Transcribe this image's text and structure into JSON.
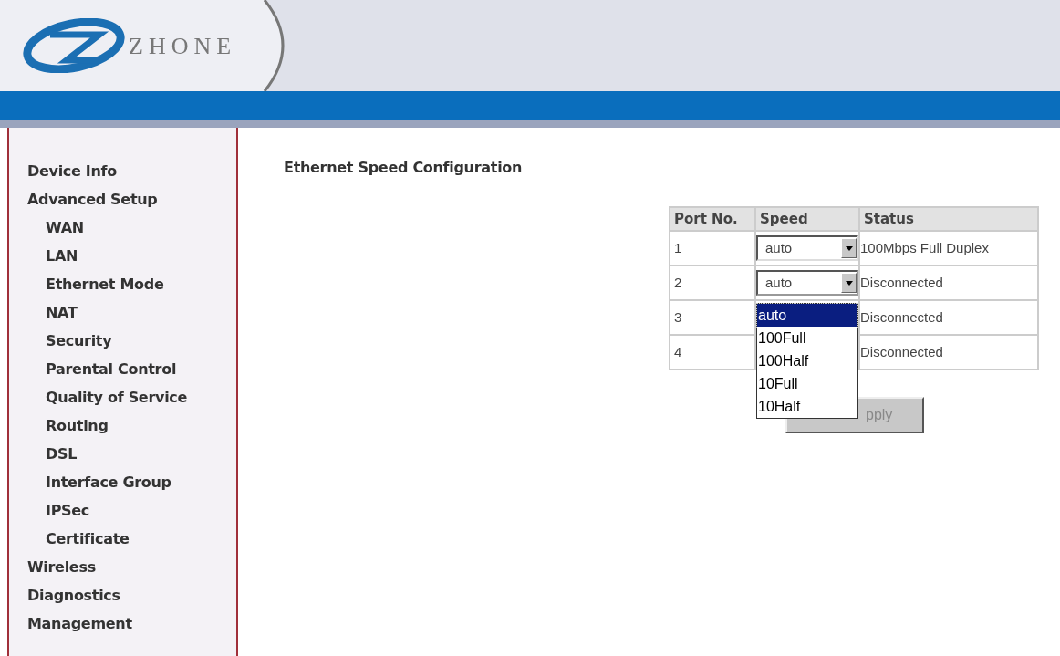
{
  "header": {
    "logo_text": "ZHONE"
  },
  "sidebar": {
    "items": [
      {
        "label": "Device Info"
      },
      {
        "label": "Advanced Setup",
        "children": [
          {
            "label": "WAN"
          },
          {
            "label": "LAN"
          },
          {
            "label": "Ethernet Mode"
          },
          {
            "label": "NAT"
          },
          {
            "label": "Security"
          },
          {
            "label": "Parental Control"
          },
          {
            "label": "Quality of Service"
          },
          {
            "label": "Routing"
          },
          {
            "label": "DSL"
          },
          {
            "label": "Interface Group"
          },
          {
            "label": "IPSec"
          },
          {
            "label": "Certificate"
          }
        ]
      },
      {
        "label": "Wireless"
      },
      {
        "label": "Diagnostics"
      },
      {
        "label": "Management"
      }
    ]
  },
  "page_title": "Ethernet Speed Configuration",
  "table": {
    "columns": [
      "Port No.",
      "Speed",
      "Status"
    ],
    "rows": [
      {
        "port": "1",
        "speed": "auto",
        "status": "100Mbps Full Duplex"
      },
      {
        "port": "2",
        "speed": "auto",
        "status": "Disconnected",
        "open": true
      },
      {
        "port": "3",
        "status": "Disconnected"
      },
      {
        "port": "4",
        "status": "Disconnected"
      }
    ]
  },
  "dropdown_options": [
    {
      "label": "auto",
      "selected": true
    },
    {
      "label": "100Full",
      "selected": false
    },
    {
      "label": "100Half",
      "selected": false
    },
    {
      "label": "10Full",
      "selected": false
    },
    {
      "label": "10Half",
      "selected": false
    }
  ],
  "apply_button": "pply"
}
